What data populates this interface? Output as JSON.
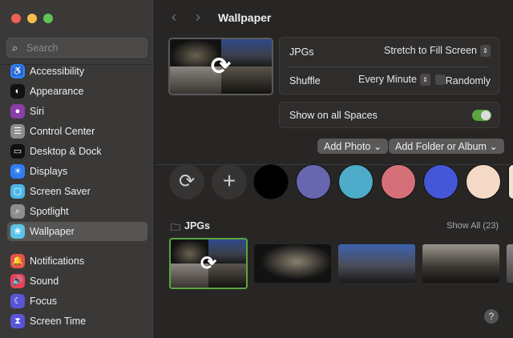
{
  "sidebar": {
    "search_placeholder": "Search",
    "items": [
      {
        "label": "Accessibility",
        "icon": "accessibility-icon",
        "color": "#2f7ef0"
      },
      {
        "label": "Appearance",
        "icon": "appearance-icon",
        "color": "#111111"
      },
      {
        "label": "Siri",
        "icon": "siri-icon",
        "color": "#8a3fa6"
      },
      {
        "label": "Control Center",
        "icon": "control-center-icon",
        "color": "#8d8d8d"
      },
      {
        "label": "Desktop & Dock",
        "icon": "desktop-dock-icon",
        "color": "#111111"
      },
      {
        "label": "Displays",
        "icon": "displays-icon",
        "color": "#2f7ef0"
      },
      {
        "label": "Screen Saver",
        "icon": "screen-saver-icon",
        "color": "#4cb7e6"
      },
      {
        "label": "Spotlight",
        "icon": "spotlight-icon",
        "color": "#8d8d8d"
      },
      {
        "label": "Wallpaper",
        "icon": "wallpaper-icon",
        "color": "#5cc3e8",
        "selected": true
      },
      {
        "label": "Notifications",
        "icon": "notifications-icon",
        "color": "#e5524b"
      },
      {
        "label": "Sound",
        "icon": "sound-icon",
        "color": "#e5425a"
      },
      {
        "label": "Focus",
        "icon": "focus-icon",
        "color": "#5a55d6"
      },
      {
        "label": "Screen Time",
        "icon": "screen-time-icon",
        "color": "#5a55d6"
      }
    ]
  },
  "header": {
    "title": "Wallpaper"
  },
  "settings": {
    "folder_label": "JPGs",
    "fit_value": "Stretch to Fill Screen",
    "shuffle_label": "Shuffle",
    "shuffle_value": "Every Minute",
    "randomly_label": "Randomly",
    "randomly_checked": false,
    "show_all_spaces_label": "Show on all Spaces",
    "show_all_spaces_on": true
  },
  "buttons": {
    "add_photo": "Add Photo",
    "add_folder": "Add Folder or Album"
  },
  "colors": [
    "#000000",
    "#6767b0",
    "#4eabc9",
    "#d5707a",
    "#4457d6",
    "#f5d9c7",
    "#efe3d2"
  ],
  "collection": {
    "title": "JPGs",
    "show_all": "Show All (23)"
  },
  "accent": "#5aa53e"
}
